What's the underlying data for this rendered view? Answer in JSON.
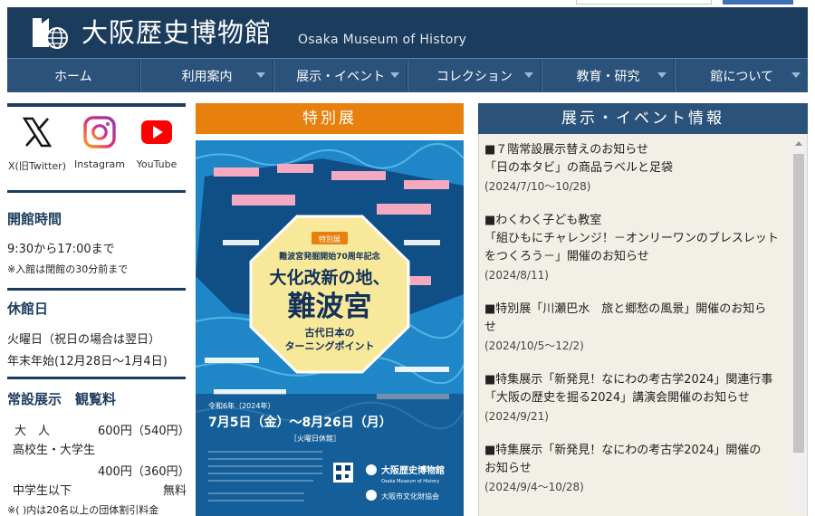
{
  "header": {
    "title_jp": "大阪歴史博物館",
    "title_en": "Osaka Museum of History"
  },
  "nav": [
    {
      "label": "ホーム",
      "dropdown": false
    },
    {
      "label": "利用案内",
      "dropdown": true
    },
    {
      "label": "展示・イベント",
      "dropdown": true
    },
    {
      "label": "コレクション",
      "dropdown": true
    },
    {
      "label": "教育・研究",
      "dropdown": true
    },
    {
      "label": "館について",
      "dropdown": true
    }
  ],
  "sns": [
    {
      "icon": "x-icon",
      "label": "X(旧Twitter)"
    },
    {
      "icon": "instagram-icon",
      "label": "Instagram"
    },
    {
      "icon": "youtube-icon",
      "label": "YouTube"
    }
  ],
  "sidebar": {
    "hours_title": "開館時間",
    "hours_time": "9:30から17:00まで",
    "hours_note": "※入館は閉館の30分前まで",
    "closed_title": "休館日",
    "closed_line1": "火曜日（祝日の場合は翌日）",
    "closed_line2": "年末年始(12月28日～1月4日)",
    "fee_title": "常設展示　観覧料",
    "fee_adult_label": "大　人",
    "fee_adult_price": "600円（540円）",
    "fee_student_label": "高校生・大学生",
    "fee_student_price": "400円（360円）",
    "fee_child_label": "中学生以下",
    "fee_child_price": "無料",
    "fee_note": "※( )内は20名以上の団体割引料金"
  },
  "special": {
    "heading": "特別展",
    "poster": {
      "badge": "特別展",
      "subtitle": "難波宮発掘開始70周年記念",
      "title_line1": "大化改新の地、",
      "title_line2": "難波宮",
      "tagline1": "古代日本の",
      "tagline2": "ターニングポイント",
      "year": "令和6年（2024年）",
      "dates": "7月5日（金）～8月26日（月）",
      "closed": "［火曜日休館］",
      "museum_jp": "大阪歴史博物館",
      "museum_en": "Osaka Museum of History",
      "assoc_jp": "大阪市文化財協会"
    }
  },
  "events": {
    "heading": "展示・イベント情報",
    "items": [
      {
        "lines": [
          "■７階常設展示替えのお知らせ",
          "「日の本タビ」の商品ラベルと足袋"
        ],
        "date": "(2024/7/10～10/28)"
      },
      {
        "lines": [
          "■わくわく子ども教室",
          "「組ひもにチャレンジ！－オンリーワンのブレスレット",
          "をつくろう－」開催のお知らせ"
        ],
        "date": "(2024/8/11)"
      },
      {
        "lines": [
          "■特別展「川瀬巴水　旅と郷愁の風景」開催のお知ら",
          "せ"
        ],
        "date": "(2024/10/5～12/2)"
      },
      {
        "lines": [
          "■特集展示「新発見！なにわの考古学2024」関連行事",
          "「大阪の歴史を掘る2024」講演会開催のお知らせ"
        ],
        "date": "(2024/9/21)"
      },
      {
        "lines": [
          "■特集展示「新発見！なにわの考古学2024」開催の",
          "お知らせ"
        ],
        "date": "(2024/9/4～10/28)"
      }
    ]
  },
  "colors": {
    "header_bg": "#1c3c5e",
    "nav_bg": "#2a527a",
    "special_accent": "#e8800d",
    "events_bg": "#f2efe6",
    "youtube_red": "#ff0000"
  }
}
